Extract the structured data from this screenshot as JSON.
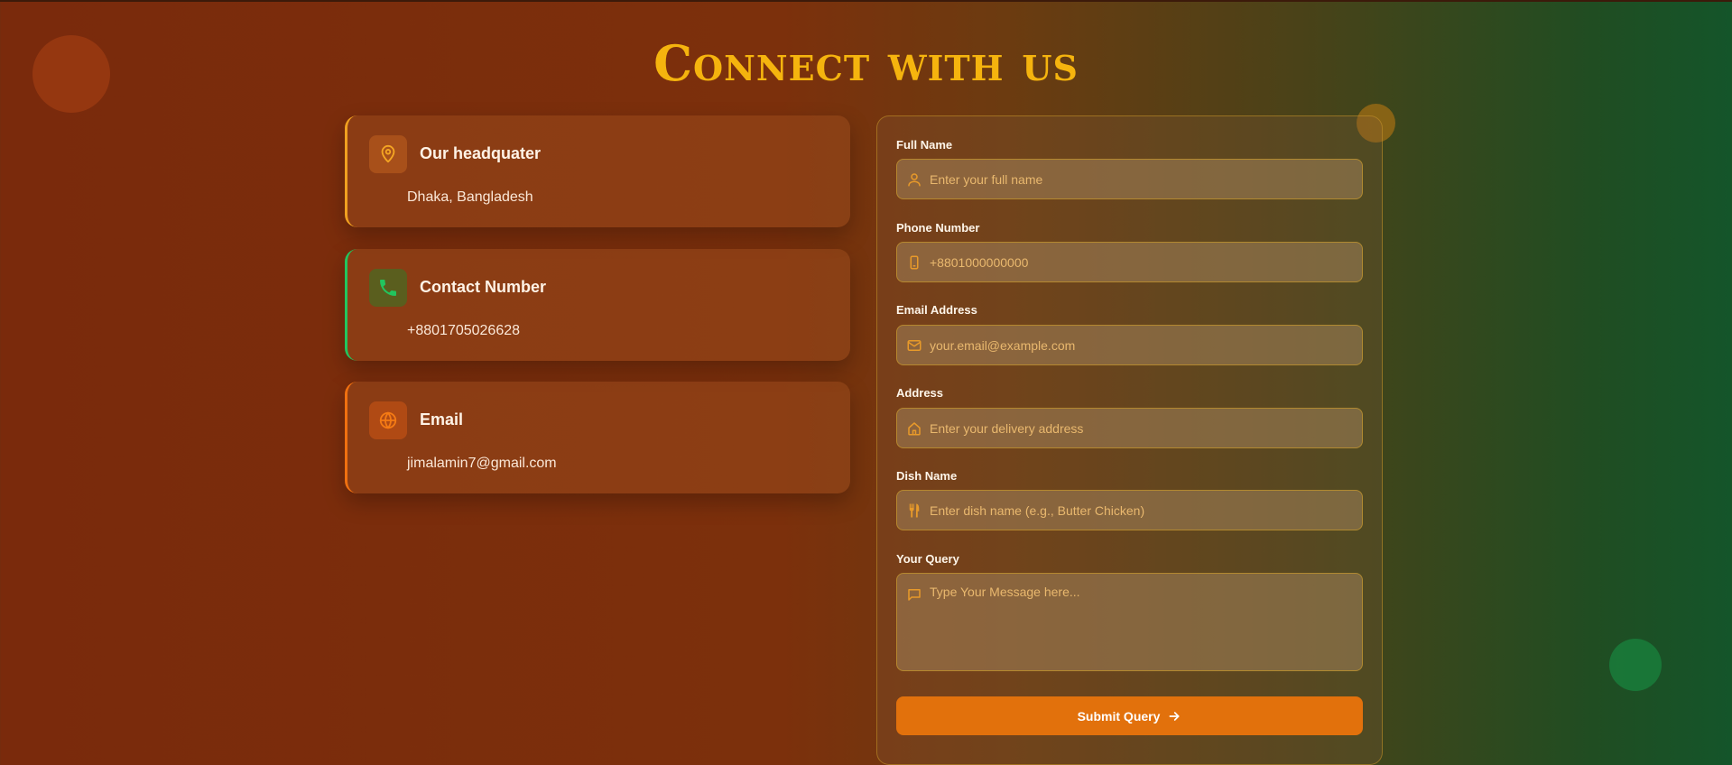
{
  "page": {
    "title": "Connect with us"
  },
  "contact_cards": [
    {
      "title": "Our headquater",
      "value": "Dhaka, Bangladesh",
      "icon": "map-pin-icon",
      "accent": "#f0a020"
    },
    {
      "title": "Contact Number",
      "value": "+8801705026628",
      "icon": "phone-icon",
      "accent": "#22c55e"
    },
    {
      "title": "Email",
      "value": "jimalamin7@gmail.com",
      "icon": "globe-icon",
      "accent": "#f07010"
    }
  ],
  "form": {
    "full_name": {
      "label": "Full Name",
      "placeholder": "Enter your full name",
      "icon": "user-icon"
    },
    "phone": {
      "label": "Phone Number",
      "placeholder": "+8801000000000",
      "icon": "smartphone-icon"
    },
    "email": {
      "label": "Email Address",
      "placeholder": "your.email@example.com",
      "icon": "mail-icon"
    },
    "address": {
      "label": "Address",
      "placeholder": "Enter your delivery address",
      "icon": "home-icon"
    },
    "dish": {
      "label": "Dish Name",
      "placeholder": "Enter dish name (e.g., Butter Chicken)",
      "icon": "utensils-icon"
    },
    "query": {
      "label": "Your Query",
      "placeholder": "Type Your Message here...",
      "icon": "message-icon"
    },
    "submit_label": "Submit Query"
  },
  "colors": {
    "title": "#f5b40e",
    "button": "#e2710c",
    "field_border": "#d2a028"
  }
}
